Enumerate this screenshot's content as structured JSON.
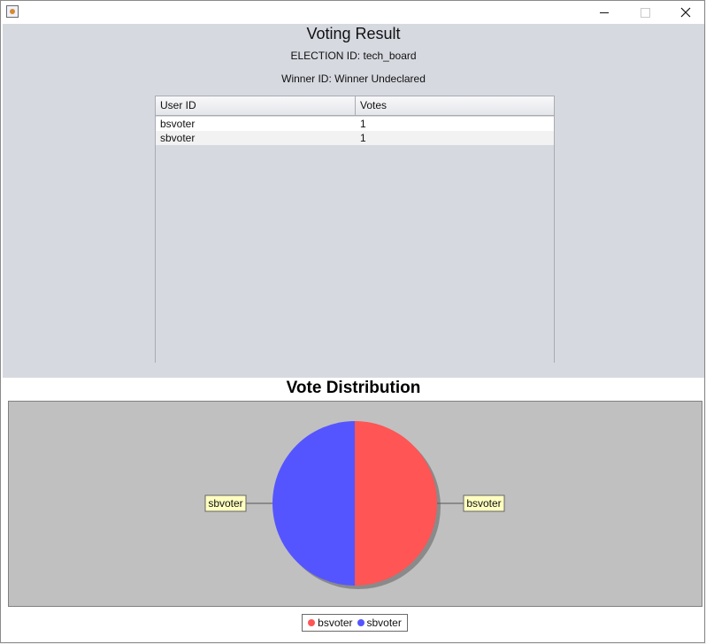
{
  "window": {
    "controls": {
      "minimize": "minimize",
      "maximize": "maximize",
      "close": "close"
    }
  },
  "header": {
    "title": "Voting Result",
    "election_label": "ELECTION ID:",
    "election_id": "tech_board",
    "winner_label": "Winner ID:",
    "winner_id": "Winner Undeclared"
  },
  "table": {
    "columns": [
      "User ID",
      "Votes"
    ],
    "rows": [
      [
        "bsvoter",
        "1"
      ],
      [
        "sbvoter",
        "1"
      ]
    ]
  },
  "chart_data": {
    "type": "pie",
    "title": "Vote Distribution",
    "categories": [
      "bsvoter",
      "sbvoter"
    ],
    "values": [
      1,
      1
    ],
    "colors": [
      "#ff5555",
      "#5555ff"
    ],
    "legend": "bottom"
  },
  "icons": {
    "app": "java-app-icon",
    "minimize": "minimize-icon",
    "maximize": "maximize-icon",
    "close": "close-icon"
  }
}
